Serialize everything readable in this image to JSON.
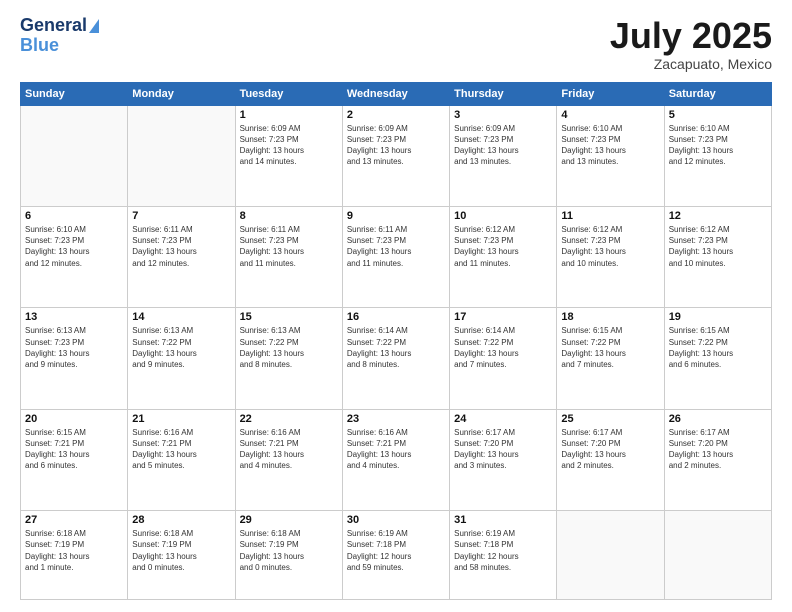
{
  "header": {
    "logo_line1": "General",
    "logo_line2": "Blue",
    "month_year": "July 2025",
    "location": "Zacapuato, Mexico"
  },
  "weekdays": [
    "Sunday",
    "Monday",
    "Tuesday",
    "Wednesday",
    "Thursday",
    "Friday",
    "Saturday"
  ],
  "weeks": [
    [
      {
        "day": "",
        "info": ""
      },
      {
        "day": "",
        "info": ""
      },
      {
        "day": "1",
        "info": "Sunrise: 6:09 AM\nSunset: 7:23 PM\nDaylight: 13 hours\nand 14 minutes."
      },
      {
        "day": "2",
        "info": "Sunrise: 6:09 AM\nSunset: 7:23 PM\nDaylight: 13 hours\nand 13 minutes."
      },
      {
        "day": "3",
        "info": "Sunrise: 6:09 AM\nSunset: 7:23 PM\nDaylight: 13 hours\nand 13 minutes."
      },
      {
        "day": "4",
        "info": "Sunrise: 6:10 AM\nSunset: 7:23 PM\nDaylight: 13 hours\nand 13 minutes."
      },
      {
        "day": "5",
        "info": "Sunrise: 6:10 AM\nSunset: 7:23 PM\nDaylight: 13 hours\nand 12 minutes."
      }
    ],
    [
      {
        "day": "6",
        "info": "Sunrise: 6:10 AM\nSunset: 7:23 PM\nDaylight: 13 hours\nand 12 minutes."
      },
      {
        "day": "7",
        "info": "Sunrise: 6:11 AM\nSunset: 7:23 PM\nDaylight: 13 hours\nand 12 minutes."
      },
      {
        "day": "8",
        "info": "Sunrise: 6:11 AM\nSunset: 7:23 PM\nDaylight: 13 hours\nand 11 minutes."
      },
      {
        "day": "9",
        "info": "Sunrise: 6:11 AM\nSunset: 7:23 PM\nDaylight: 13 hours\nand 11 minutes."
      },
      {
        "day": "10",
        "info": "Sunrise: 6:12 AM\nSunset: 7:23 PM\nDaylight: 13 hours\nand 11 minutes."
      },
      {
        "day": "11",
        "info": "Sunrise: 6:12 AM\nSunset: 7:23 PM\nDaylight: 13 hours\nand 10 minutes."
      },
      {
        "day": "12",
        "info": "Sunrise: 6:12 AM\nSunset: 7:23 PM\nDaylight: 13 hours\nand 10 minutes."
      }
    ],
    [
      {
        "day": "13",
        "info": "Sunrise: 6:13 AM\nSunset: 7:23 PM\nDaylight: 13 hours\nand 9 minutes."
      },
      {
        "day": "14",
        "info": "Sunrise: 6:13 AM\nSunset: 7:22 PM\nDaylight: 13 hours\nand 9 minutes."
      },
      {
        "day": "15",
        "info": "Sunrise: 6:13 AM\nSunset: 7:22 PM\nDaylight: 13 hours\nand 8 minutes."
      },
      {
        "day": "16",
        "info": "Sunrise: 6:14 AM\nSunset: 7:22 PM\nDaylight: 13 hours\nand 8 minutes."
      },
      {
        "day": "17",
        "info": "Sunrise: 6:14 AM\nSunset: 7:22 PM\nDaylight: 13 hours\nand 7 minutes."
      },
      {
        "day": "18",
        "info": "Sunrise: 6:15 AM\nSunset: 7:22 PM\nDaylight: 13 hours\nand 7 minutes."
      },
      {
        "day": "19",
        "info": "Sunrise: 6:15 AM\nSunset: 7:22 PM\nDaylight: 13 hours\nand 6 minutes."
      }
    ],
    [
      {
        "day": "20",
        "info": "Sunrise: 6:15 AM\nSunset: 7:21 PM\nDaylight: 13 hours\nand 6 minutes."
      },
      {
        "day": "21",
        "info": "Sunrise: 6:16 AM\nSunset: 7:21 PM\nDaylight: 13 hours\nand 5 minutes."
      },
      {
        "day": "22",
        "info": "Sunrise: 6:16 AM\nSunset: 7:21 PM\nDaylight: 13 hours\nand 4 minutes."
      },
      {
        "day": "23",
        "info": "Sunrise: 6:16 AM\nSunset: 7:21 PM\nDaylight: 13 hours\nand 4 minutes."
      },
      {
        "day": "24",
        "info": "Sunrise: 6:17 AM\nSunset: 7:20 PM\nDaylight: 13 hours\nand 3 minutes."
      },
      {
        "day": "25",
        "info": "Sunrise: 6:17 AM\nSunset: 7:20 PM\nDaylight: 13 hours\nand 2 minutes."
      },
      {
        "day": "26",
        "info": "Sunrise: 6:17 AM\nSunset: 7:20 PM\nDaylight: 13 hours\nand 2 minutes."
      }
    ],
    [
      {
        "day": "27",
        "info": "Sunrise: 6:18 AM\nSunset: 7:19 PM\nDaylight: 13 hours\nand 1 minute."
      },
      {
        "day": "28",
        "info": "Sunrise: 6:18 AM\nSunset: 7:19 PM\nDaylight: 13 hours\nand 0 minutes."
      },
      {
        "day": "29",
        "info": "Sunrise: 6:18 AM\nSunset: 7:19 PM\nDaylight: 13 hours\nand 0 minutes."
      },
      {
        "day": "30",
        "info": "Sunrise: 6:19 AM\nSunset: 7:18 PM\nDaylight: 12 hours\nand 59 minutes."
      },
      {
        "day": "31",
        "info": "Sunrise: 6:19 AM\nSunset: 7:18 PM\nDaylight: 12 hours\nand 58 minutes."
      },
      {
        "day": "",
        "info": ""
      },
      {
        "day": "",
        "info": ""
      }
    ]
  ]
}
